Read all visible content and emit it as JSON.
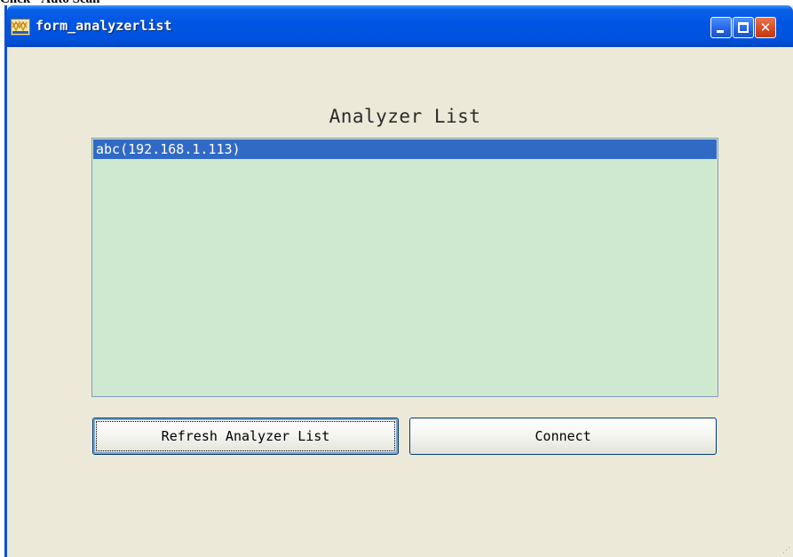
{
  "page_caption": "Click \"Auto Scan\"",
  "window": {
    "title": "form_analyzerlist",
    "icon": "app-logo-icon",
    "controls": {
      "minimize_icon": "minimize-icon",
      "maximize_icon": "maximize-icon",
      "close_icon": "close-icon",
      "close_glyph": "✕"
    }
  },
  "main": {
    "heading": "Analyzer List",
    "list": {
      "items": [
        {
          "label": "abc(192.168.1.113)",
          "selected": true
        }
      ]
    },
    "buttons": {
      "refresh_label": "Refresh Analyzer List",
      "connect_label": "Connect"
    }
  },
  "colors": {
    "titlebar": "#0054e3",
    "list_background": "#cfe8d0",
    "selection": "#316ac5",
    "window_background": "#ece9d8"
  }
}
